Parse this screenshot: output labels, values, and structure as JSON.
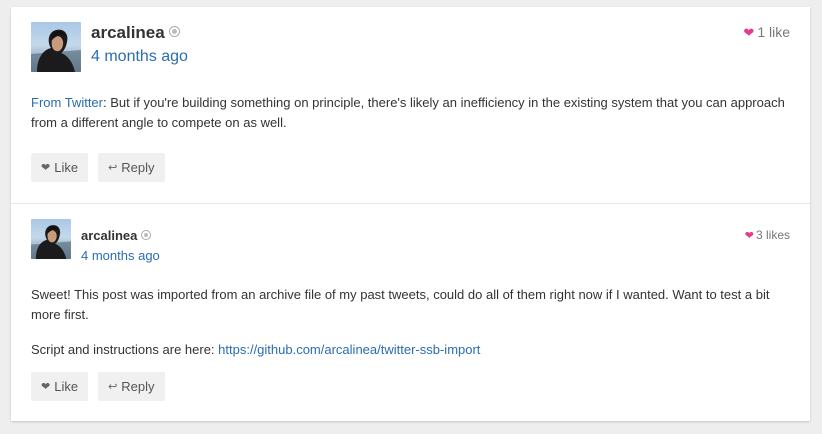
{
  "posts": [
    {
      "author": "arcalinea",
      "time": "4 months ago",
      "likes": "1 like",
      "source_link": "From Twitter",
      "text": ": But if you're building something on principle, there's likely an inefficiency in the existing system that you can approach from a different angle to compete on as well.",
      "actions": {
        "like": "Like",
        "reply": "Reply"
      }
    },
    {
      "author": "arcalinea",
      "time": "4 months ago",
      "likes": "3 likes",
      "paragraph1": "Sweet! This post was imported from an archive file of my past tweets, could do all of them right now if I wanted. Want to test a bit more first.",
      "paragraph2_prefix": "Script and instructions are here: ",
      "paragraph2_link": "https://github.com/arcalinea/twitter-ssb-import",
      "actions": {
        "like": "Like",
        "reply": "Reply"
      }
    }
  ],
  "icons": {
    "heart": "heart-icon",
    "reply": "reply-arrow-icon",
    "status": "status-dot-icon"
  },
  "colors": {
    "link": "#2a6db0",
    "heart": "#e8388a",
    "background": "#eeeeee"
  }
}
